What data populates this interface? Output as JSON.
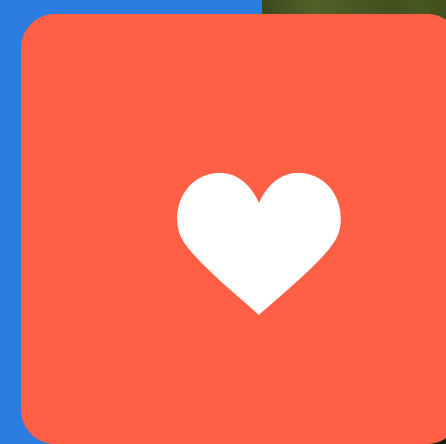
{
  "colors": {
    "backdrop_left": "#2b7de1",
    "tile_background": "#ff5f45",
    "icon_color": "#ffffff"
  },
  "app_tile": {
    "icon": "heart-icon"
  }
}
